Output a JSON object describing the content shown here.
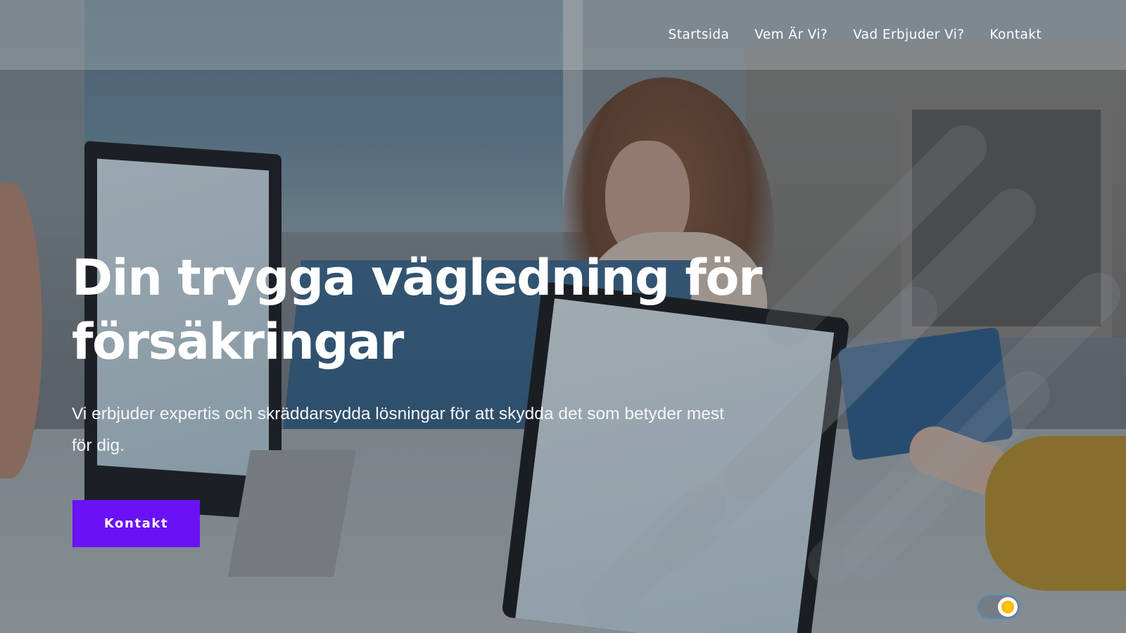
{
  "nav": {
    "items": [
      {
        "label": "Startsida"
      },
      {
        "label": "Vem Är Vi?"
      },
      {
        "label": "Vad Erbjuder Vi?"
      },
      {
        "label": "Kontakt"
      }
    ]
  },
  "hero": {
    "title_line1": "Din trygga vägledning för",
    "title_line2": "försäkringar",
    "subtitle": "Vi erbjuder expertis och skräddarsydda lösningar för att skydda det som betyder mest för dig.",
    "cta_label": "Kontakt"
  },
  "theme_toggle": {
    "mode": "light",
    "icon": "sun-icon"
  },
  "colors": {
    "accent": "#6a12f5",
    "text": "#ffffff",
    "toggle_border": "#5096d2",
    "sun": "#ffb300"
  }
}
